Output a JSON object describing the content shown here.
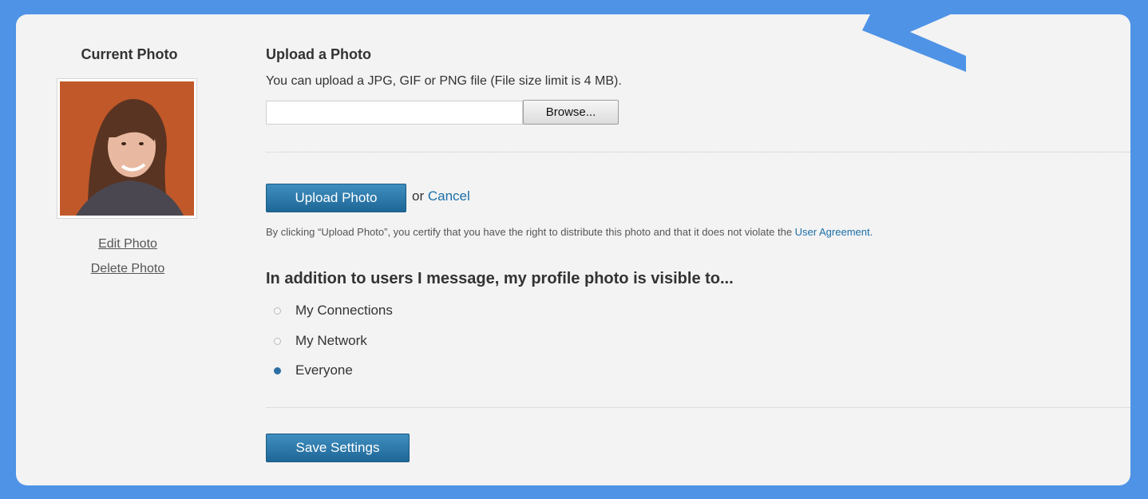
{
  "left": {
    "title": "Current Photo",
    "edit_label": "Edit Photo",
    "delete_label": "Delete Photo"
  },
  "upload": {
    "title": "Upload a Photo",
    "description": "You can upload a JPG, GIF or PNG file (File size limit is 4 MB).",
    "file_value": "",
    "browse_label": "Browse...",
    "upload_button": "Upload Photo",
    "or_text": "or",
    "cancel_label": "Cancel",
    "certify_text": "By clicking “Upload Photo”, you certify that you have the right to distribute this photo and that it does not violate the",
    "agreement_label": "User Agreement."
  },
  "visibility": {
    "title": "In addition to users I message, my profile photo is visible to...",
    "options": [
      {
        "label": "My Connections",
        "selected": false
      },
      {
        "label": "My Network",
        "selected": false
      },
      {
        "label": "Everyone",
        "selected": true
      }
    ],
    "save_label": "Save Settings"
  },
  "colors": {
    "frame": "#4f93e6",
    "button": "#1e6796",
    "link": "#1c6fa8"
  }
}
